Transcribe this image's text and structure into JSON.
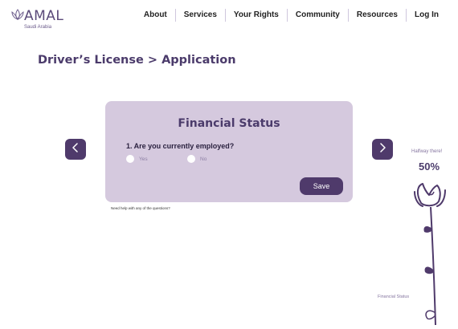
{
  "brand": {
    "name": "AMAL",
    "tagline": "Saudi Arabia",
    "logo_icon": "lotus-icon"
  },
  "nav": {
    "items": [
      "About",
      "Services",
      "Your Rights",
      "Community",
      "Resources",
      "Log In"
    ]
  },
  "breadcrumb": {
    "text": "Driver’s License > Application"
  },
  "card": {
    "title": "Financial Status",
    "question": "1. Are you currently employed?",
    "options": [
      "Yes",
      "No"
    ],
    "save_label": "Save"
  },
  "help_text": "Need help with any of the questions?",
  "nav_arrows": {
    "prev_icon": "chevron-left-icon",
    "next_icon": "chevron-right-icon"
  },
  "progress": {
    "message": "Halfway there!",
    "percent_label": "50%",
    "value": 0.5,
    "current_section": "Financial Status",
    "graphic_icon": "rose-icon"
  },
  "colors": {
    "primary": "#4f3a6b",
    "card_bg": "#d5c9de",
    "heading": "#4b3b6b"
  }
}
